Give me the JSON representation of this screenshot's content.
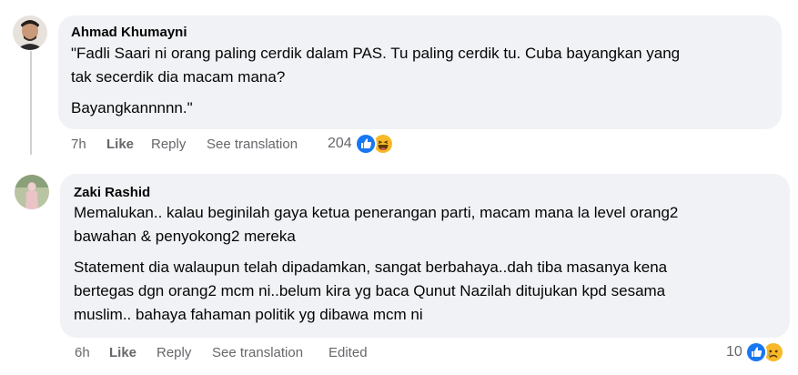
{
  "comments": [
    {
      "author": "Ahmad Khumayni",
      "paragraphs": [
        "\"Fadli Saari ni orang paling cerdik dalam PAS. Tu paling cerdik tu. Cuba bayangkan yang",
        "tak secerdik dia macam mana?",
        "Bayangkannnnn.\""
      ],
      "time": "7h",
      "like_label": "Like",
      "reply_label": "Reply",
      "translate_label": "See translation",
      "reaction_count": "204",
      "reaction_icons": [
        "like-icon",
        "haha-icon"
      ]
    },
    {
      "author": "Zaki Rashid",
      "paragraphs": [
        "Memalukan.. kalau beginilah gaya ketua penerangan parti, macam mana la level orang2",
        "bawahan & penyokong2 mereka",
        "Statement dia walaupun telah dipadamkan, sangat berbahaya..dah tiba masanya kena",
        "bertegas dgn orang2 mcm ni..belum kira yg baca Qunut Nazilah ditujukan kpd sesama",
        "muslim.. bahaya fahaman politik yg dibawa mcm ni"
      ],
      "time": "6h",
      "like_label": "Like",
      "reply_label": "Reply",
      "translate_label": "See translation",
      "edited_label": "Edited",
      "reaction_count": "10",
      "reaction_icons": [
        "like-icon",
        "sad-icon"
      ]
    }
  ],
  "colors": {
    "bubble": "#f0f2f5",
    "meta_text": "#65676b",
    "like_blue": "#1877f2",
    "haha_yellow": "#f7b928"
  }
}
